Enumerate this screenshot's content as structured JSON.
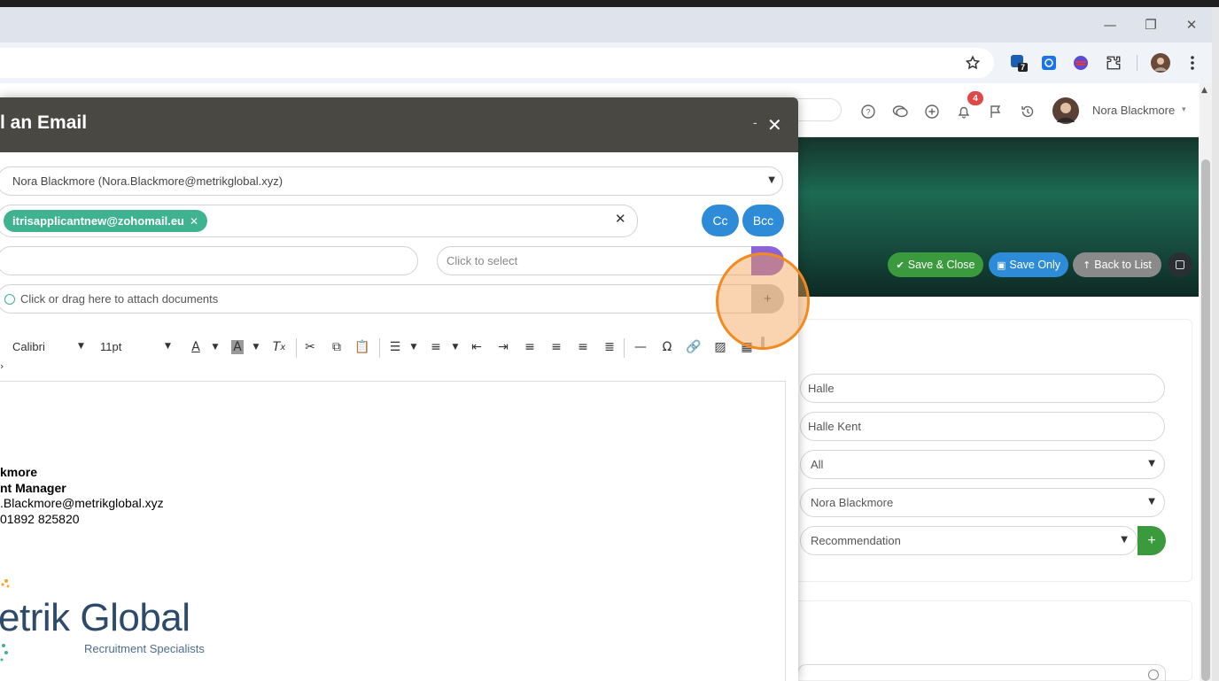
{
  "browser": {
    "window_controls": {
      "minimize": "—",
      "restore": "❐",
      "close": "✕"
    },
    "extension_badge": "7",
    "icons": [
      "star-icon",
      "extension-counter-icon",
      "snowflake-icon",
      "globe-icon",
      "puzzle-icon",
      "profile-avatar",
      "kebab-menu-icon"
    ]
  },
  "app": {
    "notifications_count": "4",
    "user_name": "Nora Blackmore",
    "actions": {
      "save_close": "Save & Close",
      "save_only": "Save Only",
      "back_to_list": "Back to List"
    },
    "form": {
      "field1": "Halle",
      "field2": "Halle Kent",
      "field3": "All",
      "field4": "Nora Blackmore",
      "field5": "Recommendation",
      "add": "+"
    }
  },
  "modal": {
    "title": "l an Email",
    "minimize": "-",
    "close": "✕",
    "from": "Nora Blackmore (Nora.Blackmore@metrikglobal.xyz)",
    "to_tag": "itrisapplicantnew@zohomail.eu",
    "cc": "Cc",
    "bcc": "Bcc",
    "template_placeholder": "Click to select",
    "attach": "Click or drag here to attach documents",
    "attach_add": "+",
    "font": "Calibri",
    "size": "11pt",
    "signature": {
      "name": "kmore",
      "role": "nt Manager",
      "email": ".Blackmore@metrikglobal.xyz",
      "phone": "01892 825820",
      "logo_text": "etrik Global",
      "logo_sub": "Recruitment Specialists"
    }
  },
  "colors": {
    "accent": "#2e8bd8",
    "tag": "#3fb28f",
    "highlight": "#f28a20",
    "save_close": "#3a9a3d",
    "save_only": "#2e8bd8",
    "back": "#8a8a8a"
  }
}
